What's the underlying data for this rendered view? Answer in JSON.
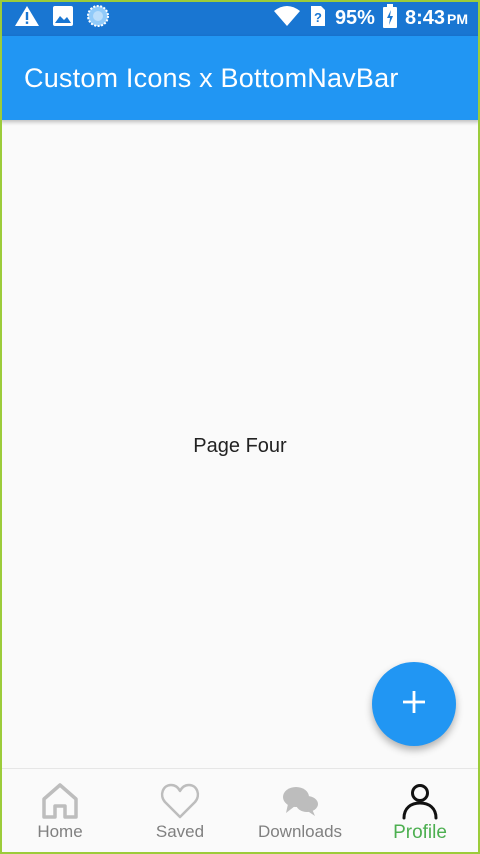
{
  "status_bar": {
    "battery": "95%",
    "time": "8:43",
    "ampm": "PM",
    "icons": [
      "warning-icon",
      "image-icon",
      "sync-icon",
      "wifi-icon",
      "sim-icon",
      "battery-charging-icon"
    ]
  },
  "app_bar": {
    "title": "Custom Icons x BottomNavBar"
  },
  "body": {
    "text": "Page Four"
  },
  "fab": {
    "icon": "plus-icon",
    "color": "#2196f3"
  },
  "bottom_nav": {
    "active_index": 3,
    "active_color": "#4caf50",
    "inactive_color": "#808080",
    "items": [
      {
        "label": "Home",
        "icon": "home-icon"
      },
      {
        "label": "Saved",
        "icon": "heart-icon"
      },
      {
        "label": "Downloads",
        "icon": "chat-icon"
      },
      {
        "label": "Profile",
        "icon": "person-icon"
      }
    ]
  },
  "colors": {
    "status_bar": "#1976d2",
    "app_bar": "#2196f3",
    "background": "#fafafa"
  }
}
